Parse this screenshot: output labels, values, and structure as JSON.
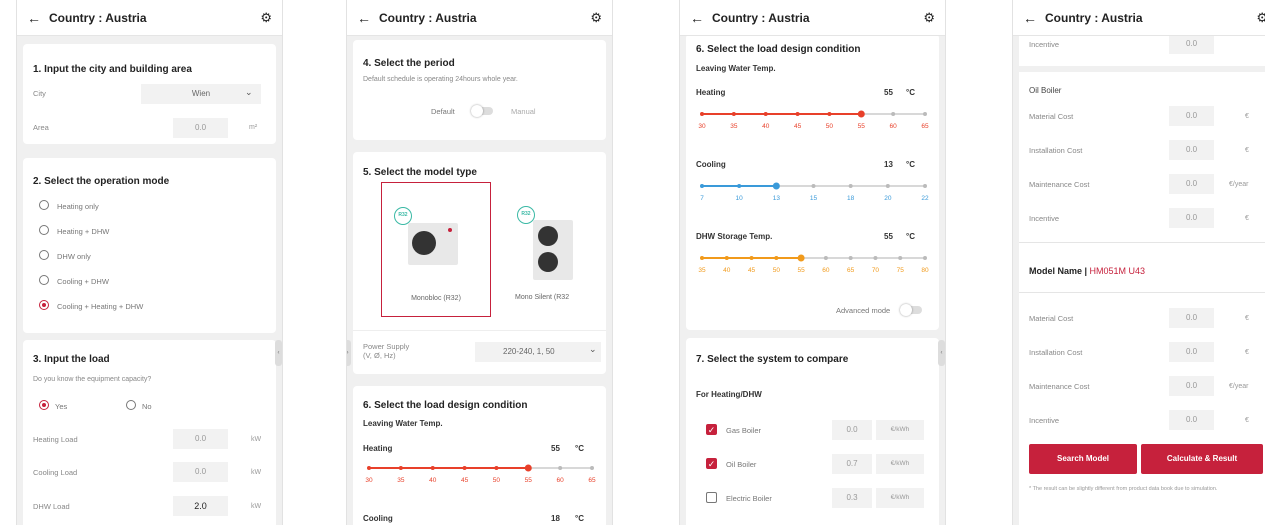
{
  "common": {
    "title": "Country : Austria",
    "back_icon": "←",
    "gear_icon": "⚙",
    "chevron_icon": "⌄",
    "accent": "#c6213c",
    "heating_color": "#e8402a",
    "cooling_color": "#3a9ad9",
    "dhw_color": "#f19a1b"
  },
  "screen1": {
    "s1_title": "1. Input the city and building area",
    "city_label": "City",
    "city_value": "Wien",
    "area_label": "Area",
    "area_value": "0.0",
    "area_unit": "m²",
    "s2_title": "2. Select the operation mode",
    "modes": [
      "Heating only",
      "Heating + DHW",
      "DHW only",
      "Cooling + DHW",
      "Cooling + Heating + DHW"
    ],
    "selected_mode": "Cooling + Heating + DHW",
    "s3_title": "3. Input the load",
    "capacity_question": "Do you know the equipment capacity?",
    "yes": "Yes",
    "no": "No",
    "loads": [
      {
        "label": "Heating Load",
        "value": "0.0",
        "unit": "kW"
      },
      {
        "label": "Cooling Load",
        "value": "0.0",
        "unit": "kW"
      },
      {
        "label": "DHW Load",
        "value": "2.0",
        "unit": "kW"
      }
    ]
  },
  "screen2": {
    "s4_title": "4. Select the period",
    "s4_hint": "Default schedule is operating 24hours whole year.",
    "default_label": "Default",
    "manual_label": "Manual",
    "s5_title": "5. Select the model type",
    "badge": "R32",
    "model1": "Monobloc (R32)",
    "model2": "Mono Silent (R32",
    "power_label": "Power Supply\n(V, Ø, Hz)",
    "power_value": "220-240, 1, 50",
    "s6_title": "6. Select the load design condition",
    "lwt_label": "Leaving Water Temp.",
    "heating_label": "Heating",
    "heating_value": "55",
    "deg": "°C",
    "heating_ticks": [
      "30",
      "35",
      "40",
      "45",
      "50",
      "55",
      "60",
      "65"
    ],
    "heating_selected": 55,
    "cooling_label": "Cooling",
    "cooling_value": "18"
  },
  "screen3": {
    "s6_title": "6. Select the load design condition",
    "lwt_label": "Leaving Water Temp.",
    "heating_label": "Heating",
    "heating_value": "55",
    "heating_ticks": [
      "30",
      "35",
      "40",
      "45",
      "50",
      "55",
      "60",
      "65"
    ],
    "heating_selected": 55,
    "cooling_label": "Cooling",
    "cooling_value": "13",
    "cooling_ticks": [
      "7",
      "10",
      "13",
      "15",
      "18",
      "20",
      "22"
    ],
    "cooling_selected": 13,
    "dhw_label": "DHW Storage Temp.",
    "dhw_value": "55",
    "dhw_ticks": [
      "35",
      "40",
      "45",
      "50",
      "55",
      "60",
      "65",
      "70",
      "75",
      "80"
    ],
    "dhw_selected": 55,
    "deg": "°C",
    "advanced_label": "Advanced mode",
    "s7_title": "7. Select the system to compare",
    "compare_sub": "For Heating/DHW",
    "systems": [
      {
        "label": "Gas Boiler",
        "value": "0.0",
        "unit": "€/kWh",
        "checked": true
      },
      {
        "label": "Oil Boiler",
        "value": "0.7",
        "unit": "€/kWh",
        "checked": true
      },
      {
        "label": "Electric Boiler",
        "value": "0.3",
        "unit": "€/kWh",
        "checked": false
      }
    ]
  },
  "screen4": {
    "top_cut": "Incentive",
    "top_cut_value": "0.0",
    "oil_title": "Oil Boiler",
    "oil_rows": [
      {
        "label": "Material Cost",
        "value": "0.0",
        "unit": "€"
      },
      {
        "label": "Installation Cost",
        "value": "0.0",
        "unit": "€"
      },
      {
        "label": "Maintenance Cost",
        "value": "0.0",
        "unit": "€/year"
      },
      {
        "label": "Incentive",
        "value": "0.0",
        "unit": "€"
      }
    ],
    "model_prefix": "Model Name | ",
    "model_name": "HM051M U43",
    "model_rows": [
      {
        "label": "Material Cost",
        "value": "0.0",
        "unit": "€"
      },
      {
        "label": "Installation Cost",
        "value": "0.0",
        "unit": "€"
      },
      {
        "label": "Maintenance Cost",
        "value": "0.0",
        "unit": "€/year"
      },
      {
        "label": "Incentive",
        "value": "0.0",
        "unit": "€"
      }
    ],
    "search_button": "Search Model",
    "calc_button": "Calculate & Result",
    "footnote": "* The result can be slightly different from product data book due to simulation."
  }
}
